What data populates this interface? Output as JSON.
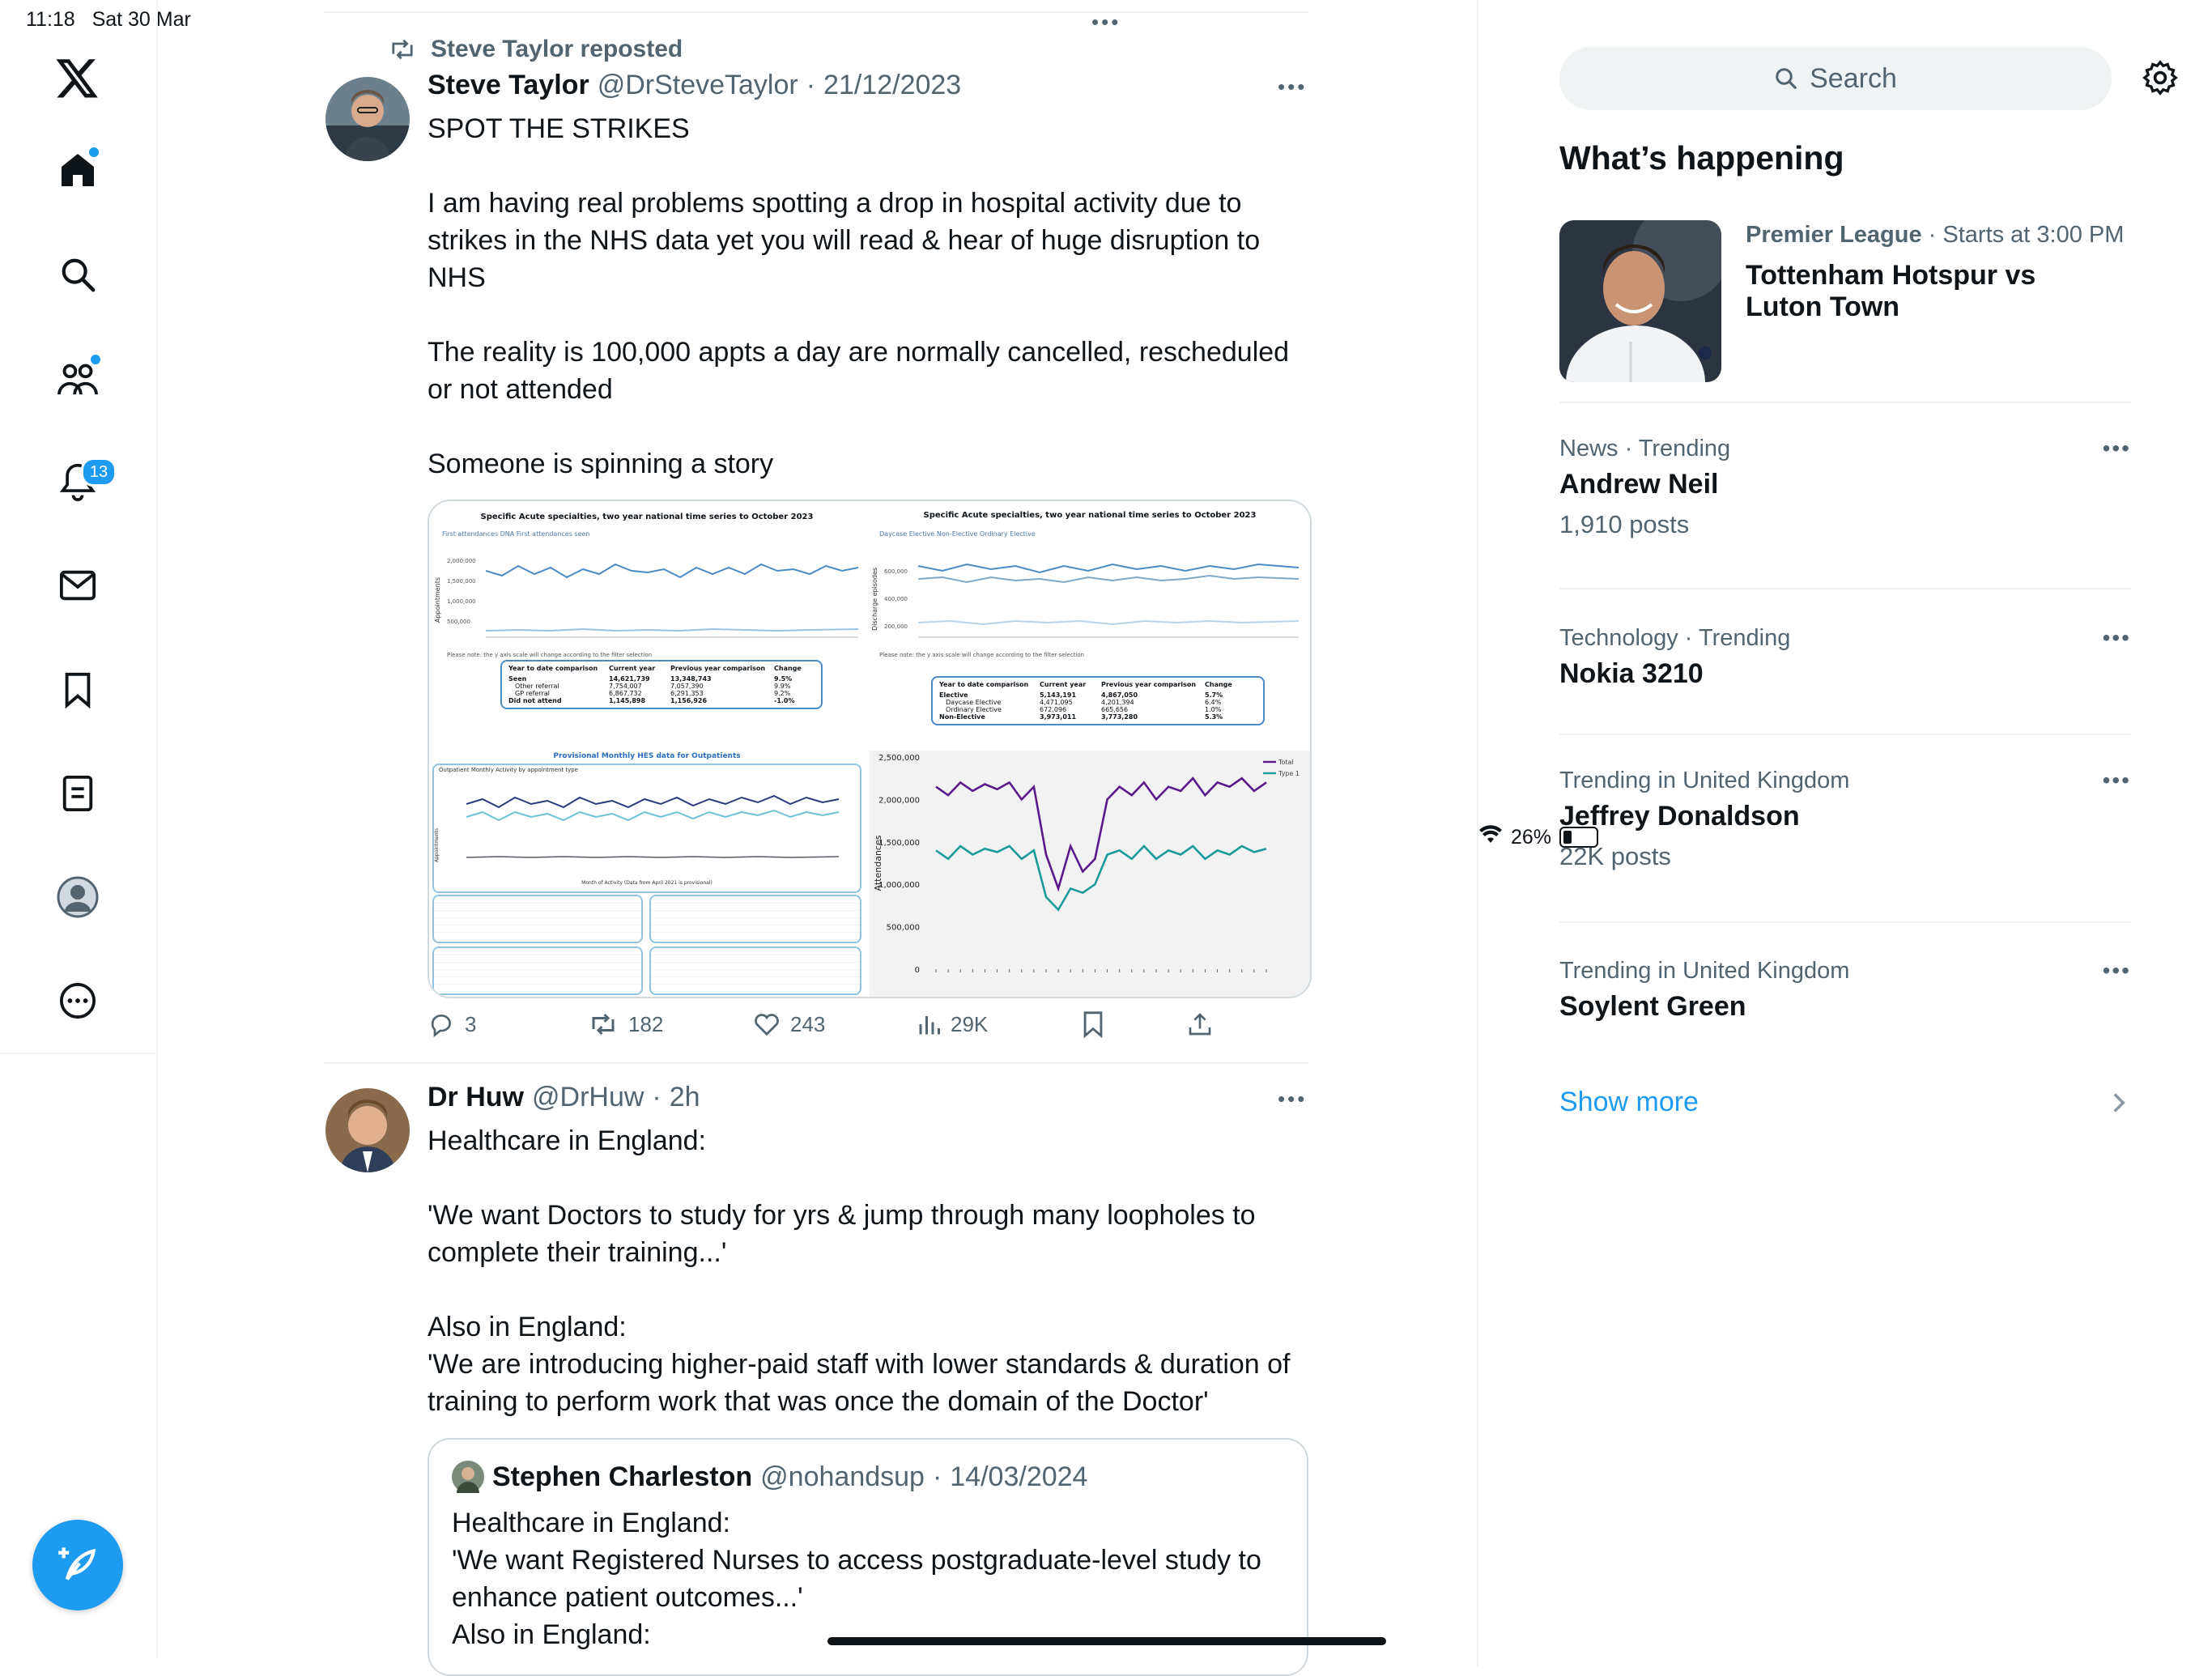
{
  "status_bar": {
    "time": "11:18",
    "date": "Sat 30 Mar",
    "battery": "26%"
  },
  "nav": {
    "notification_count": "13"
  },
  "tweet1": {
    "repost_label": "Steve Taylor reposted",
    "author_name": "Steve Taylor",
    "handle": "@DrSteveTaylor",
    "dot": "·",
    "date": "21/12/2023",
    "line1": "SPOT THE STRIKES",
    "para1": "I am having real problems spotting a drop in hospital activity due to strikes in the NHS data yet you will read & hear of huge disruption to NHS",
    "para2": "The reality is 100,000 appts a day are normally cancelled, rescheduled or not attended",
    "para3": "Someone is spinning a story",
    "replies": "3",
    "reposts": "182",
    "likes": "243",
    "views": "29K",
    "images": {
      "panel1_title": "Specific Acute specialties, two year national time series to October 2023",
      "panel1_legend": "First attendances DNA   First attendances seen",
      "panel1_yticks": [
        "2,000,000",
        "1,500,000",
        "1,000,000",
        "500,000"
      ],
      "panel1_ylabel": "Appointments",
      "panel1_note": "Please note: the y axis scale will change according to the filter selection",
      "panel1_table": {
        "headers": [
          "Year to date comparison",
          "Current year",
          "Previous year comparison",
          "Change"
        ],
        "rows": [
          [
            "Seen",
            "14,621,739",
            "13,348,743",
            "9.5%"
          ],
          [
            "Other referral",
            "7,754,007",
            "7,057,390",
            "9.9%"
          ],
          [
            "GP referral",
            "6,867,732",
            "6,291,353",
            "9.2%"
          ],
          [
            "Did not attend",
            "1,145,898",
            "1,156,926",
            "-1.0%"
          ]
        ]
      },
      "panel2_title": "Specific Acute specialties, two year national time series to October 2023",
      "panel2_legend": "Daycase Elective   Non-Elective   Ordinary Elective",
      "panel2_yticks": [
        "600,000",
        "400,000",
        "200,000"
      ],
      "panel2_ylabel": "Discharge episodes",
      "panel2_note": "Please note: the y axis scale will change according to the filter selection",
      "panel2_table": {
        "headers": [
          "Year to date comparison",
          "Current year",
          "Previous year comparison",
          "Change"
        ],
        "rows": [
          [
            "Elective",
            "5,143,191",
            "4,867,050",
            "5.7%"
          ],
          [
            "Daycase Elective",
            "4,471,095",
            "4,201,394",
            "6.4%"
          ],
          [
            "Ordinary Elective",
            "672,096",
            "665,656",
            "1.0%"
          ],
          [
            "Non-Elective",
            "3,973,011",
            "3,773,280",
            "5.3%"
          ]
        ]
      },
      "panel3_title": "Provisional Monthly HES data for Outpatients",
      "panel3_subtitle": "Outpatient Monthly Activity by appointment type",
      "panel3_xlabel": "Month of Activity (Data from April 2021 is provisional)",
      "panel3_ylabel": "Appointments",
      "panel4_ylabel": "Attendances",
      "panel4_legend": [
        "Total",
        "Type 1"
      ]
    },
    "chart_data": {
      "type": "line",
      "ylabel": "Attendances",
      "ylim": [
        0,
        2500000
      ],
      "yticks": [
        "2,500,000",
        "2,000,000",
        "1,500,000",
        "1,000,000",
        "500,000",
        "0"
      ],
      "series": [
        {
          "name": "Total",
          "color": "#5b1a8b",
          "values": [
            2150000,
            2050000,
            2200000,
            2100000,
            2180000,
            2120000,
            2200000,
            2000000,
            2150000,
            1350000,
            950000,
            1450000,
            1150000,
            1300000,
            2000000,
            2150000,
            2050000,
            2200000,
            2000000,
            2150000,
            2100000,
            2250000,
            2050000,
            2200000,
            2150000,
            2250000,
            2100000,
            2200000
          ]
        },
        {
          "name": "Type 1",
          "color": "#1a9a9a",
          "values": [
            1400000,
            1300000,
            1450000,
            1350000,
            1420000,
            1380000,
            1450000,
            1300000,
            1400000,
            850000,
            700000,
            950000,
            900000,
            1000000,
            1350000,
            1400000,
            1300000,
            1450000,
            1300000,
            1400000,
            1350000,
            1450000,
            1300000,
            1400000,
            1350000,
            1450000,
            1380000,
            1420000
          ]
        }
      ]
    }
  },
  "tweet2": {
    "author_name": "Dr Huw",
    "handle": "@DrHuw",
    "dot": "·",
    "time": "2h",
    "line1": "Healthcare in England:",
    "para1": "'We want Doctors to study for yrs & jump through many loopholes to complete their training...'",
    "para2a": "Also in England:",
    "para2b": "'We are introducing higher-paid staff with lower standards & duration of training to perform work that was once the domain of the Doctor'",
    "quote": {
      "author_name": "Stephen Charleston",
      "handle": "@nohandsup",
      "dot": "·",
      "date": "14/03/2024",
      "line1": "Healthcare in England:",
      "line2": "'We want Registered Nurses to access postgraduate-level study to enhance patient outcomes...'",
      "line3": "Also in England:"
    }
  },
  "right": {
    "search_placeholder": "Search",
    "heading": "What’s happening",
    "featured": {
      "league": "Premier League",
      "starts": " · Starts at 3:00 PM",
      "match_line1": "Tottenham Hotspur vs",
      "match_line2": "Luton Town"
    },
    "trends": [
      {
        "context": "News · Trending",
        "name": "Andrew Neil",
        "count": "1,910 posts"
      },
      {
        "context": "Technology · Trending",
        "name": "Nokia 3210",
        "count": ""
      },
      {
        "context": "Trending in United Kingdom",
        "name": "Jeffrey Donaldson",
        "count": "22K posts"
      },
      {
        "context": "Trending in United Kingdom",
        "name": "Soylent Green",
        "count": ""
      }
    ],
    "show_more": "Show more"
  },
  "colors": {
    "accent": "#1d9bf0",
    "text": "#0f1419",
    "muted": "#536471",
    "border": "#eff3f4"
  }
}
